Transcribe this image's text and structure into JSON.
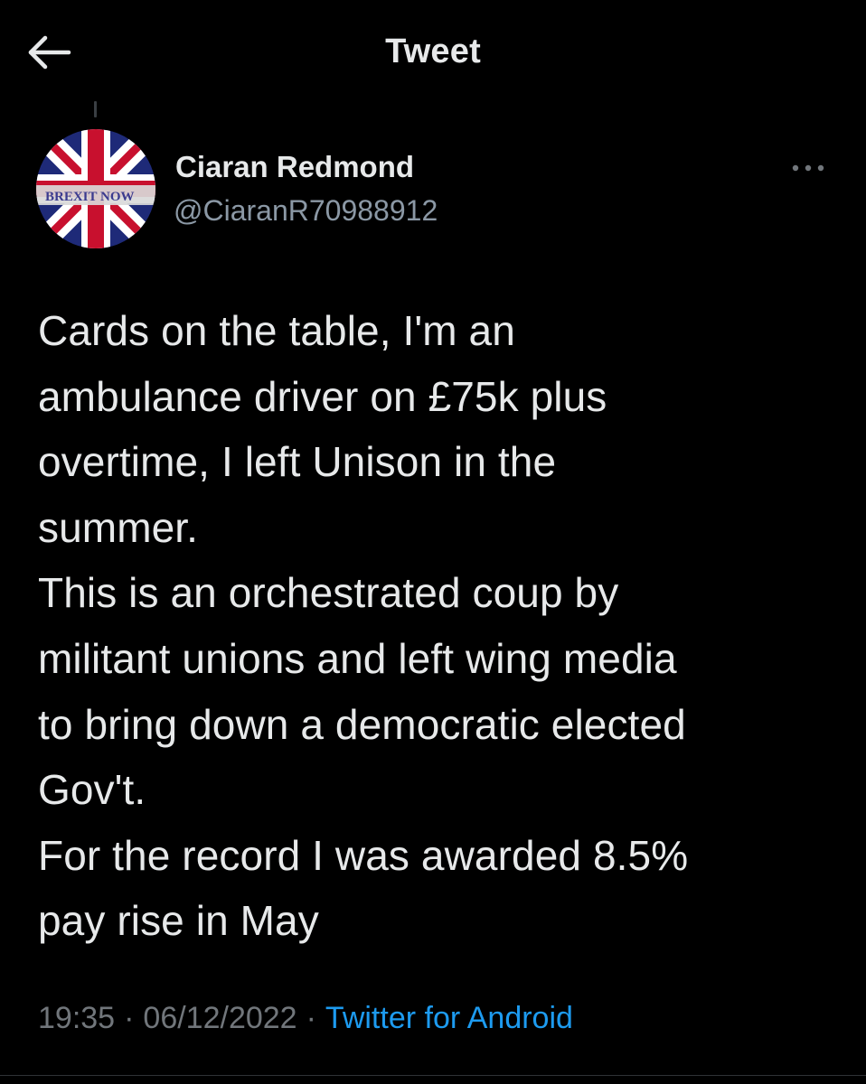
{
  "header": {
    "title": "Tweet",
    "back_icon": "arrow-left-icon"
  },
  "tweet": {
    "author": {
      "name": "Ciaran Redmond",
      "handle": "@CiaranR70988912",
      "avatar_banner_text": "BREXIT NOW"
    },
    "more_icon": "more-horizontal-icon",
    "text_lines": [
      "Cards on the table, I'm an",
      "ambulance driver on £75k plus",
      "overtime, I left Unison in the",
      "summer.",
      "This is an orchestrated coup by",
      "militant unions and left wing media",
      "to bring down a democratic elected",
      "Gov't.",
      "For the record I was awarded 8.5%",
      "pay rise in May"
    ],
    "time": "19:35",
    "date": "06/12/2022",
    "separator": "·",
    "source": "Twitter for Android"
  },
  "colors": {
    "background": "#000000",
    "text_primary": "#e7e9ea",
    "text_secondary": "#71767b",
    "handle": "#8b98a5",
    "accent_link": "#1d9bf0"
  }
}
